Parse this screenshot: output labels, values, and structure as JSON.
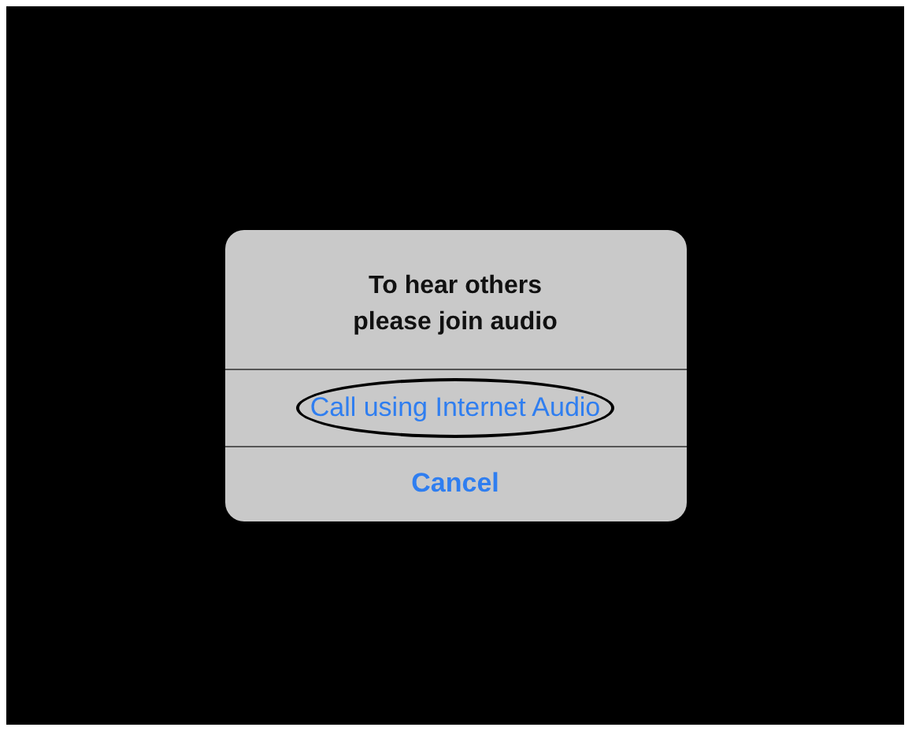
{
  "alert": {
    "message": "To hear others\nplease join audio",
    "actions": [
      {
        "label": "Call using Internet Audio",
        "kind": "default",
        "circled": true
      },
      {
        "label": "Cancel",
        "kind": "cancel",
        "circled": false
      }
    ]
  }
}
